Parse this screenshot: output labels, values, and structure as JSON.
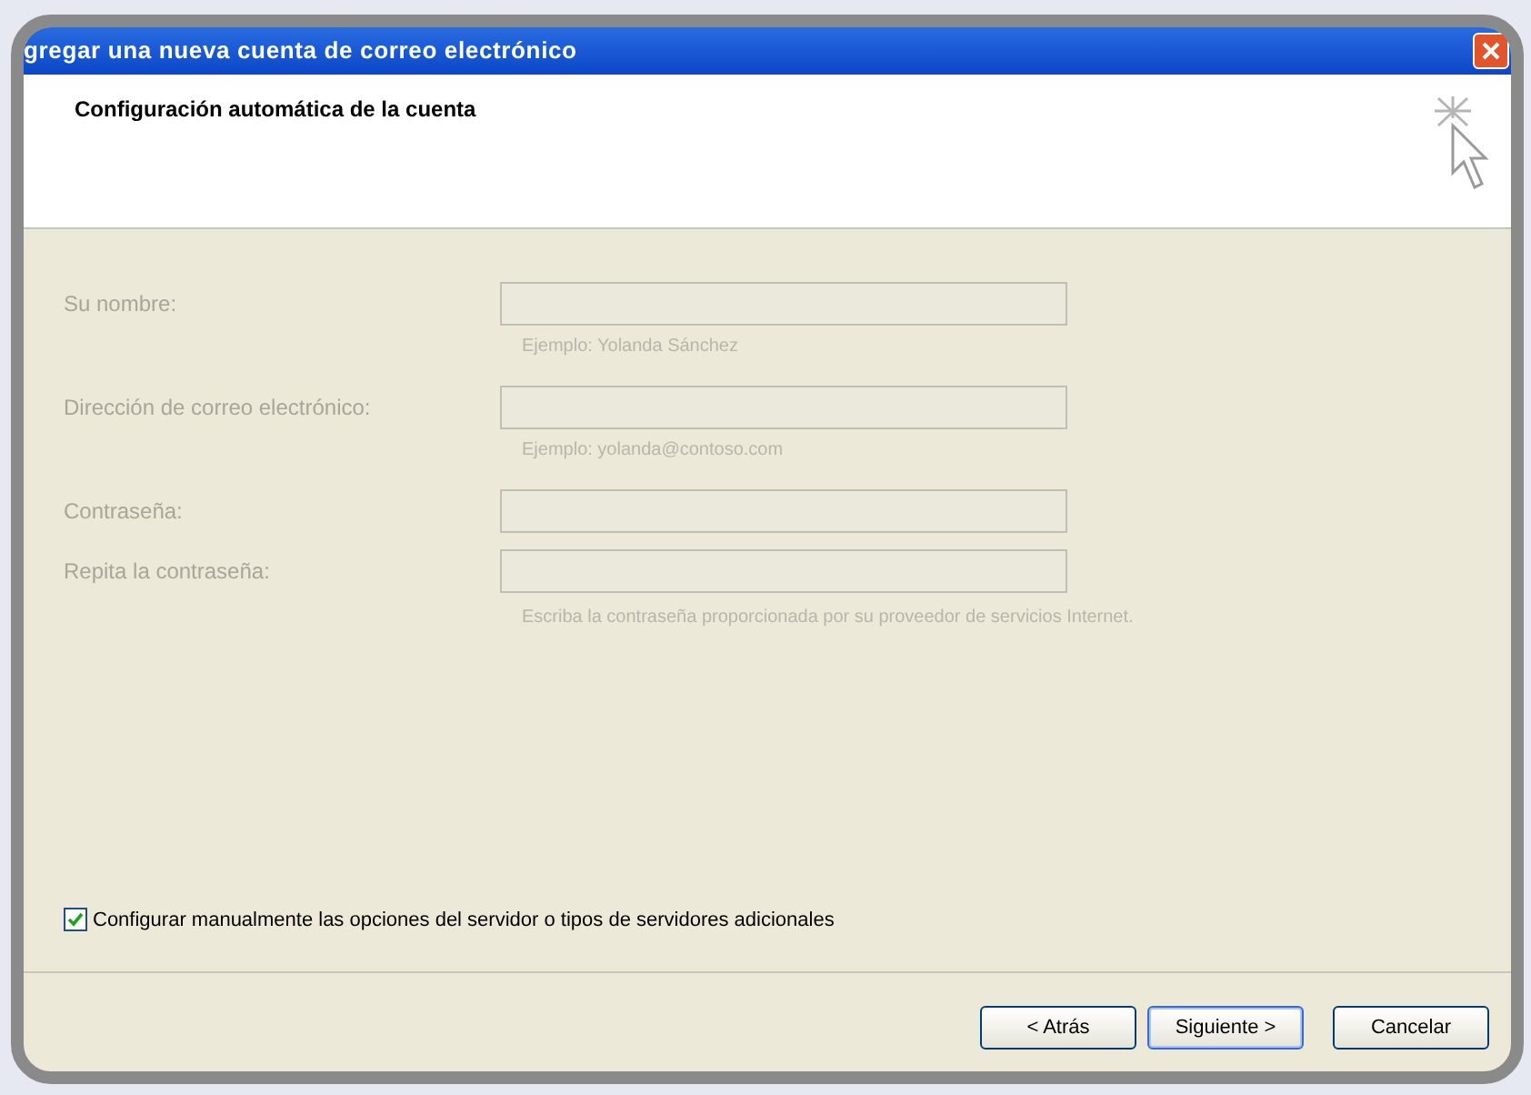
{
  "window": {
    "title": "gregar una nueva cuenta de correo electrónico"
  },
  "header": {
    "title": "Configuración automática de la cuenta"
  },
  "fields": [
    {
      "label": "Su nombre:",
      "disabled": true,
      "hint": "Ejemplo: Yolanda Sánchez"
    },
    {
      "label": "Dirección de correo electrónico:",
      "disabled": true,
      "hint": "Ejemplo: yolanda@contoso.com"
    },
    {
      "label": "Contraseña:",
      "disabled": true
    },
    {
      "label": "Repita la contraseña:",
      "disabled": true,
      "hint": "Escriba la contraseña proporcionada por su proveedor de servicios Internet."
    }
  ],
  "manual_option": {
    "label": "Configurar manualmente las opciones del servidor o tipos de servidores adicionales",
    "checked": true
  },
  "buttons": [
    {
      "label": "< Atrás",
      "selected": false
    },
    {
      "label": "Siguiente >",
      "selected": true
    },
    {
      "label": "Cancelar",
      "selected": false
    }
  ]
}
